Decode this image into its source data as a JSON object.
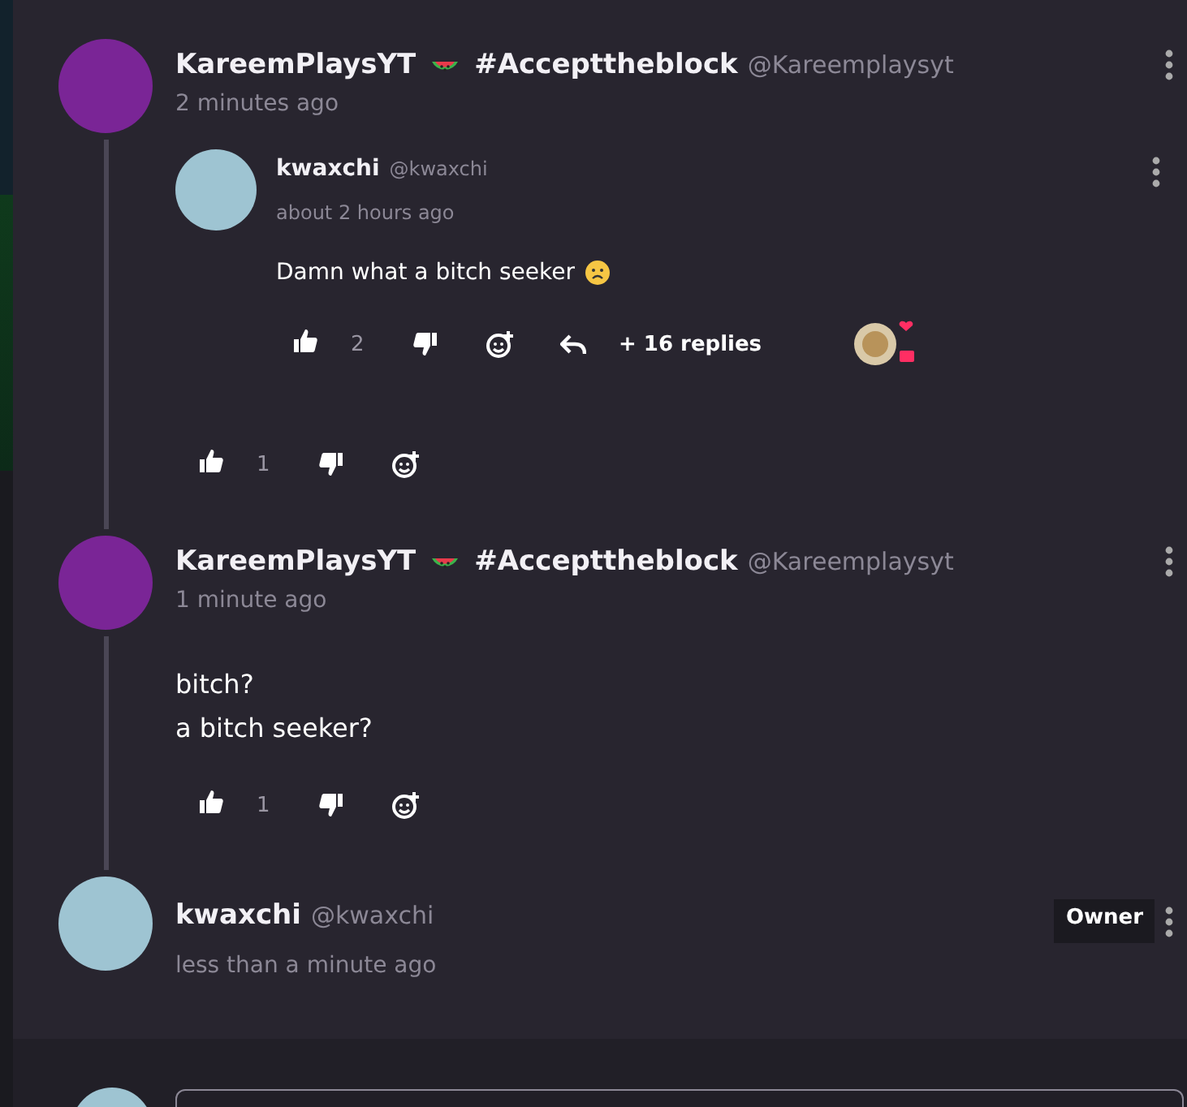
{
  "comments": [
    {
      "author": "KareemPlaysYT",
      "tag": "#Accepttheblock",
      "handle": "@Kareemplaysyt",
      "time": "2 minutes ago",
      "color": "#7a2596",
      "replies": [
        {
          "author": "kwaxchi",
          "handle": "@kwaxchi",
          "time": "about 2 hours ago",
          "color": "#9ec4d2",
          "body": [
            "Damn what a bitch seeker"
          ],
          "likes": "2",
          "more_replies": "+ 16 replies"
        }
      ],
      "likes": "1"
    },
    {
      "author": "KareemPlaysYT",
      "tag": "#Accepttheblock",
      "handle": "@Kareemplaysyt",
      "time": "1 minute ago",
      "color": "#7a2596",
      "body": [
        "bitch?",
        "a bitch seeker?"
      ],
      "likes": "1"
    },
    {
      "author": "kwaxchi",
      "handle": "@kwaxchi",
      "time": "less than a minute ago",
      "color": "#9ec4d2",
      "owner_badge": "Owner"
    }
  ]
}
